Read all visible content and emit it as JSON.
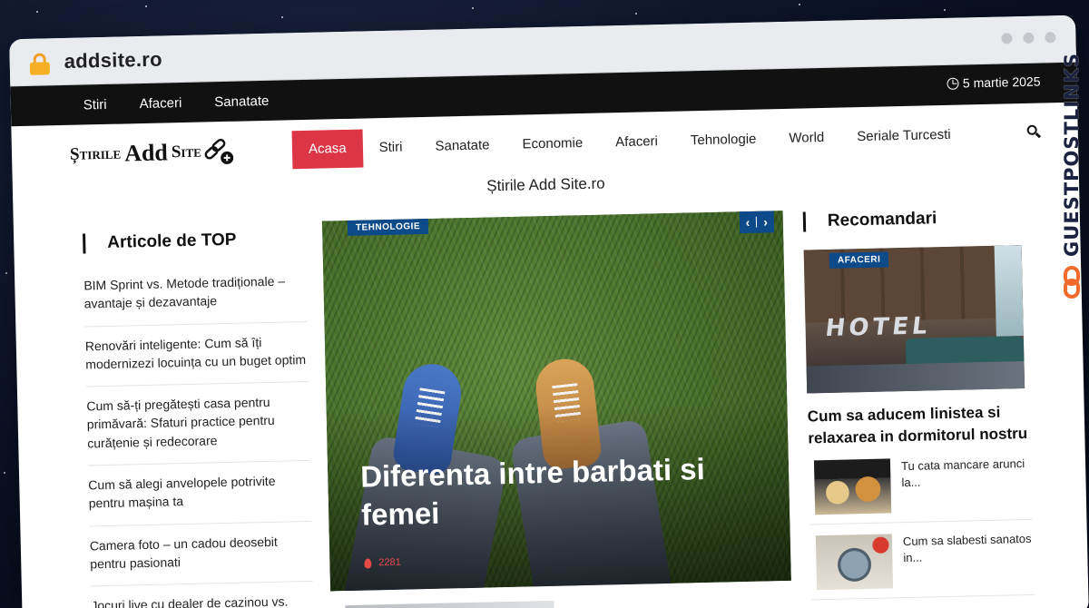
{
  "browser": {
    "url": "addsite.ro"
  },
  "topbar": {
    "links": [
      "Stiri",
      "Afaceri",
      "Sanatate"
    ],
    "date": "5 martie 2025"
  },
  "logo": {
    "text_1": "Știrile",
    "text_2": "Add",
    "text_3": "Site"
  },
  "nav": {
    "items": [
      "Acasa",
      "Stiri",
      "Sanatate",
      "Economie",
      "Afaceri",
      "Tehnologie",
      "World",
      "Seriale Turcesti"
    ],
    "active": "Acasa"
  },
  "tagline": "Știrile Add Site.ro",
  "left": {
    "title": "Articole de TOP",
    "items": [
      "BIM Sprint vs. Metode tradiționale – avantaje și dezavantaje",
      "Renovări inteligente: Cum să îți modernizezi locuința cu un buget optim",
      "Cum să-ți pregătești casa pentru primăvară: Sfaturi practice pentru curățenie și redecorare",
      "Cum să alegi anvelopele potrivite pentru mașina ta",
      "Camera foto – un cadou deosebit pentru pasionati",
      "Jocuri live cu dealer de cazinou vs."
    ]
  },
  "hero": {
    "category": "TEHNOLOGIE",
    "title": "Diferenta intre barbati si femei",
    "views": "2281",
    "prev": "‹",
    "next": "›"
  },
  "right": {
    "title": "Recomandari",
    "featured": {
      "category": "AFACERI",
      "image_text": "HOTEL",
      "title": "Cum sa aducem linistea si relaxarea in dormitorul nostru"
    },
    "items": [
      {
        "title": "Tu cata mancare arunci la..."
      },
      {
        "title": "Cum sa slabesti sanatos in..."
      }
    ]
  },
  "watermark": "GUESTPOSTLINKS",
  "colors": {
    "accent_red": "#dc3545",
    "badge_blue": "#0d4a8a",
    "topbar": "#111111"
  }
}
